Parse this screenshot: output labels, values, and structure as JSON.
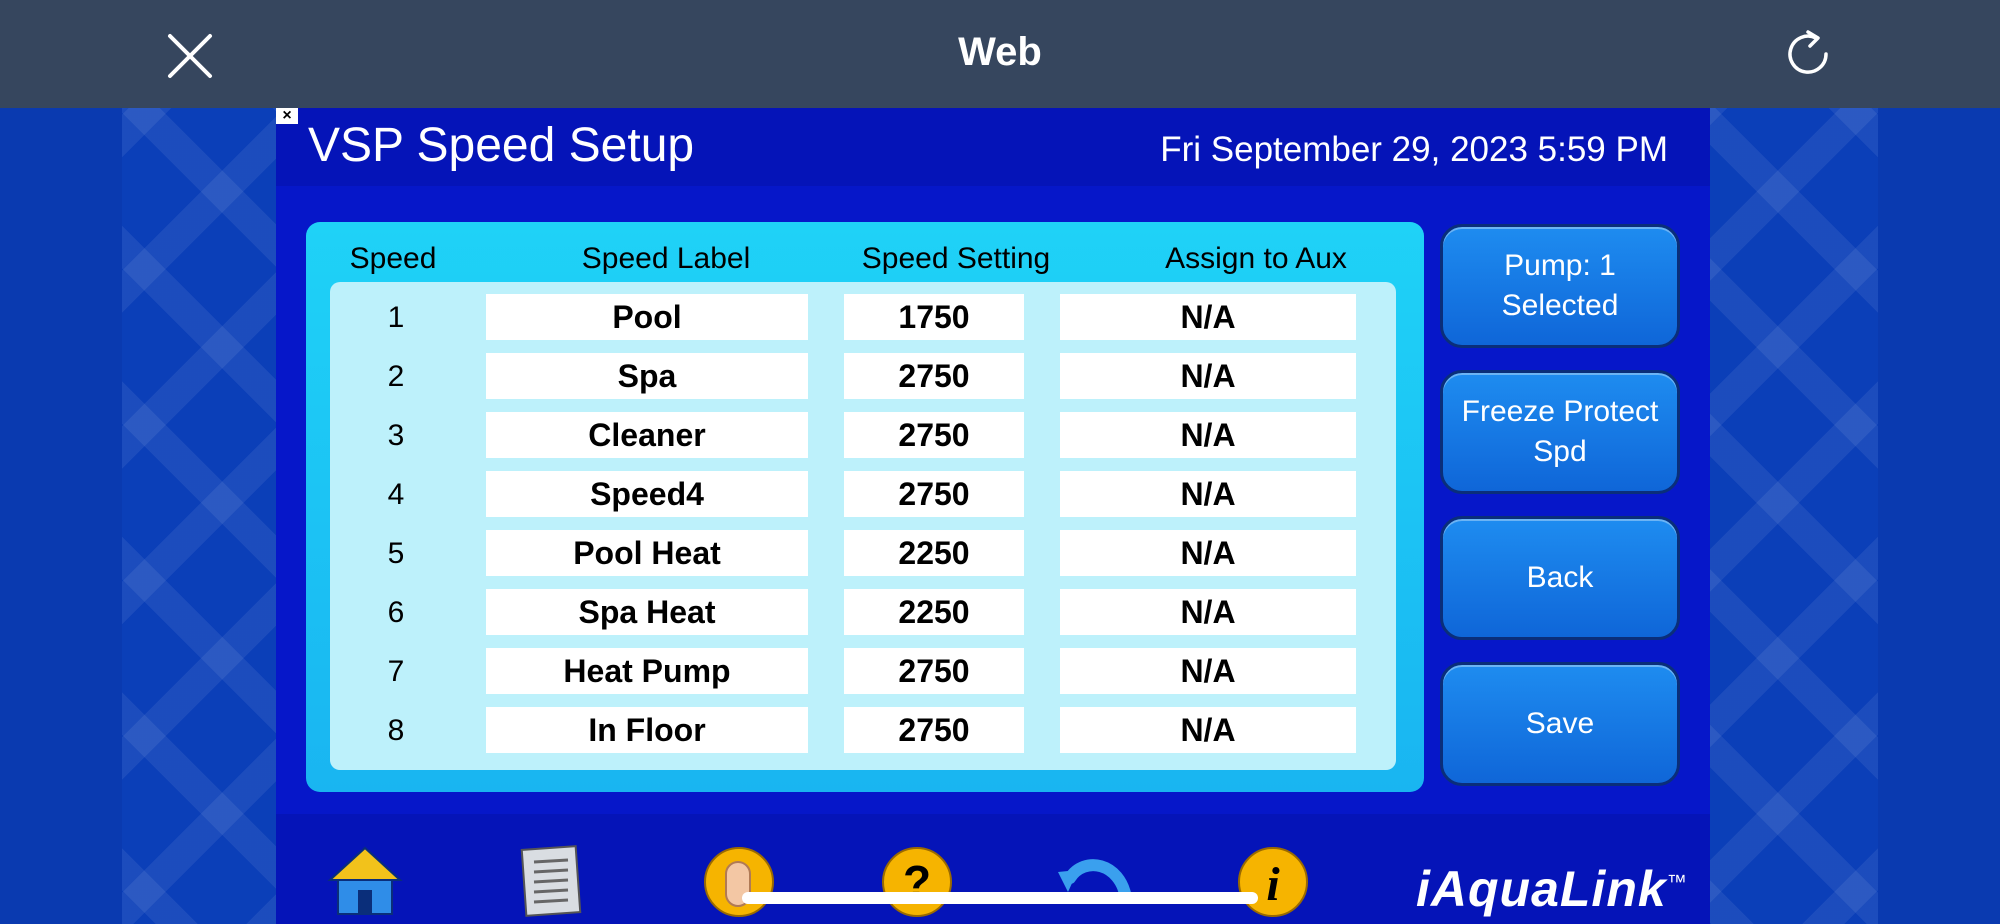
{
  "browser": {
    "title": "Web"
  },
  "app": {
    "page_title": "VSP Speed Setup",
    "datetime": "Fri September 29, 2023 5:59 PM",
    "columns": {
      "speed": "Speed",
      "label": "Speed Label",
      "setting": "Speed Setting",
      "aux": "Assign to Aux"
    },
    "rows": [
      {
        "num": "1",
        "label": "Pool",
        "setting": "1750",
        "aux": "N/A"
      },
      {
        "num": "2",
        "label": "Spa",
        "setting": "2750",
        "aux": "N/A"
      },
      {
        "num": "3",
        "label": "Cleaner",
        "setting": "2750",
        "aux": "N/A"
      },
      {
        "num": "4",
        "label": "Speed4",
        "setting": "2750",
        "aux": "N/A"
      },
      {
        "num": "5",
        "label": "Pool Heat",
        "setting": "2250",
        "aux": "N/A"
      },
      {
        "num": "6",
        "label": "Spa Heat",
        "setting": "2250",
        "aux": "N/A"
      },
      {
        "num": "7",
        "label": "Heat Pump",
        "setting": "2750",
        "aux": "N/A"
      },
      {
        "num": "8",
        "label": "In Floor",
        "setting": "2750",
        "aux": "N/A"
      }
    ],
    "buttons": {
      "pump": "Pump: 1\nSelected",
      "freeze": "Freeze Protect\nSpd",
      "back": "Back",
      "save": "Save"
    },
    "nav": [
      {
        "icon": "home-icon"
      },
      {
        "icon": "menu-icon"
      },
      {
        "icon": "one-touch-icon"
      },
      {
        "icon": "help-icon"
      },
      {
        "icon": "back-arrow-icon"
      },
      {
        "icon": "info-icon"
      }
    ],
    "logo": "iAquaLink",
    "logo_mark": "™"
  },
  "colors": {
    "topbar": "#36465e",
    "panel": "#0617c9",
    "table_frame": "#1fd2f7",
    "table_inner": "#bdf1fb",
    "button": "#1e8cf0"
  }
}
